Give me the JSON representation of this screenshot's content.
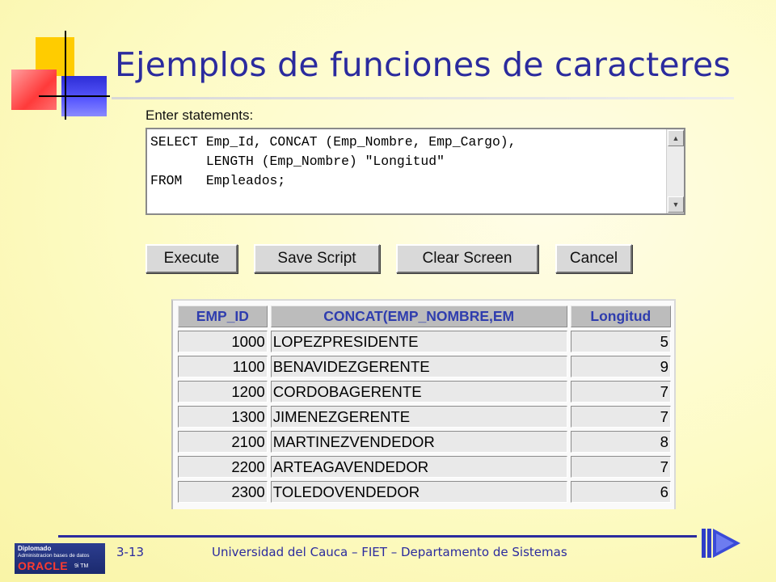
{
  "slide": {
    "title": "Ejemplos de funciones de caracteres",
    "page_number": "3-13",
    "footer_text": "Universidad del Cauca – FIET – Departamento de Sistemas"
  },
  "logo": {
    "line1": "Diplomado",
    "line2": "Administracion bases de datos",
    "line3": "ORACLE",
    "line4": "9i TM"
  },
  "editor": {
    "label": "Enter statements:",
    "sql": "SELECT Emp_Id, CONCAT (Emp_Nombre, Emp_Cargo),\n       LENGTH (Emp_Nombre) \"Longitud\"\nFROM   Empleados;"
  },
  "buttons": {
    "execute": "Execute",
    "save_script": "Save Script",
    "clear_screen": "Clear Screen",
    "cancel": "Cancel"
  },
  "results": {
    "columns": [
      "EMP_ID",
      "CONCAT(EMP_NOMBRE,EM",
      "Longitud"
    ],
    "rows": [
      [
        "1000",
        "LOPEZPRESIDENTE",
        "5"
      ],
      [
        "1100",
        "BENAVIDEZGERENTE",
        "9"
      ],
      [
        "1200",
        "CORDOBAGERENTE",
        "7"
      ],
      [
        "1300",
        "JIMENEZGERENTE",
        "7"
      ],
      [
        "2100",
        "MARTINEZVENDEDOR",
        "8"
      ],
      [
        "2200",
        "ARTEAGAVENDEDOR",
        "7"
      ],
      [
        "2300",
        "TOLEDOVENDEDOR",
        "6"
      ]
    ]
  },
  "colors": {
    "title_blue": "#2b2b9e",
    "header_text_blue": "#2f3dae",
    "slide_background": "#fdfbc4"
  }
}
